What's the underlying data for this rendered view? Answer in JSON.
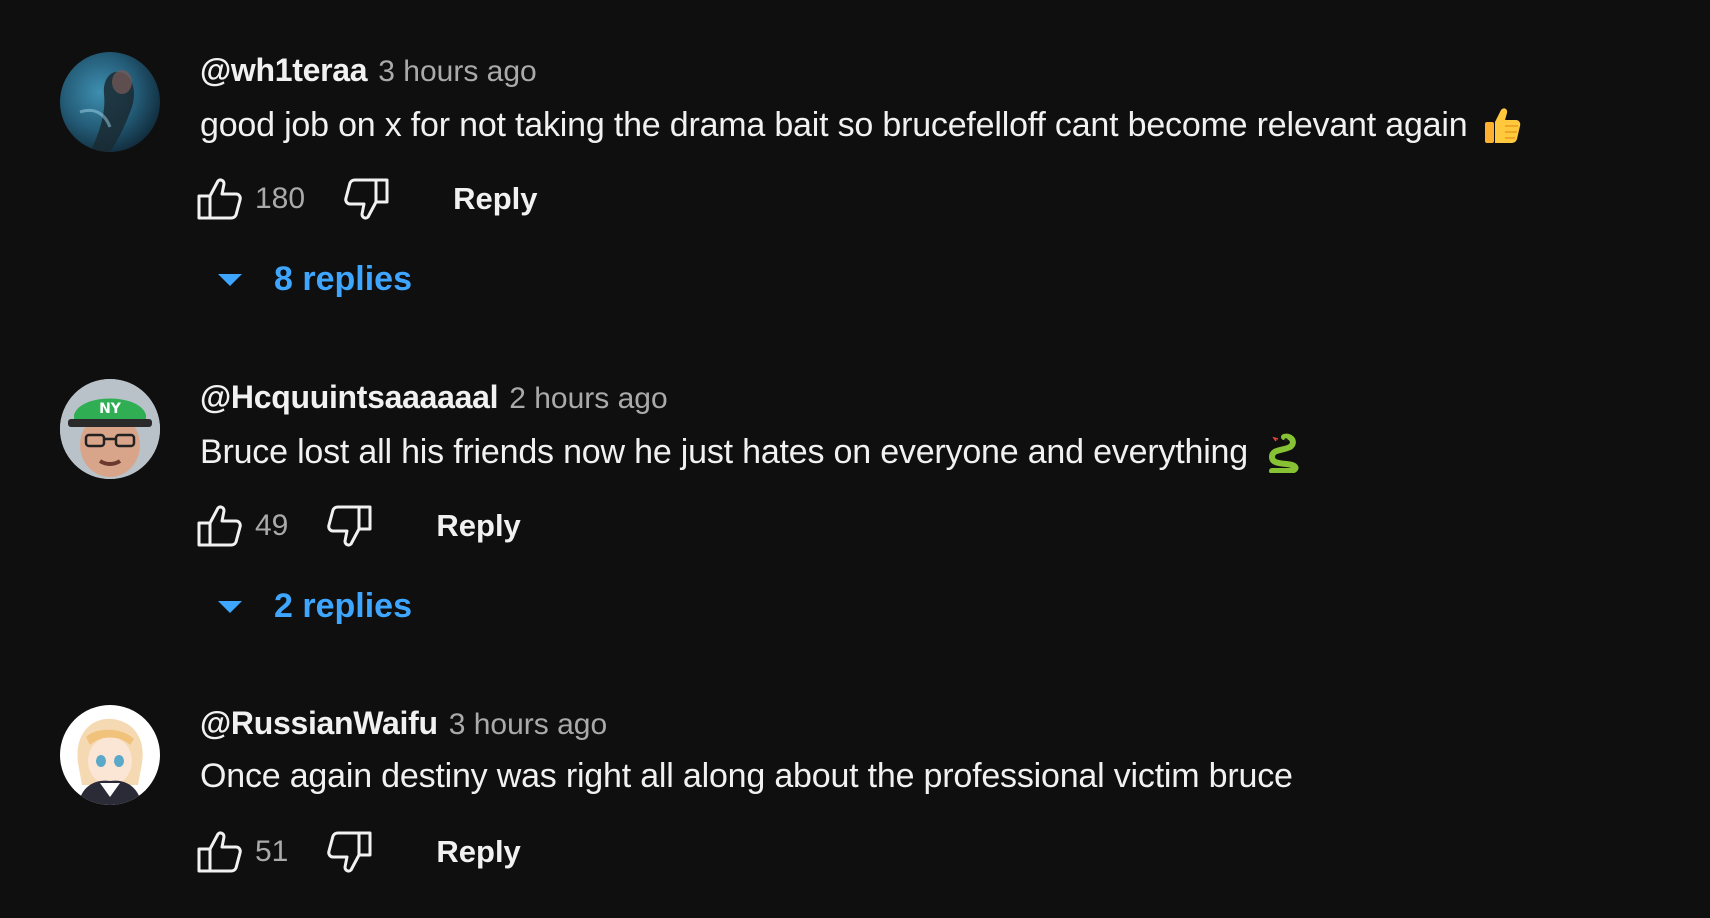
{
  "comments": [
    {
      "author": "@wh1teraa",
      "time": "3 hours ago",
      "text": "good job on x for not taking the drama bait so brucefelloff cant become relevant again",
      "emoji": "thumbs-up-emoji",
      "likes": "180",
      "reply_label": "Reply",
      "replies_label": "8 replies",
      "avatar": "dark-blue-photo-avatar"
    },
    {
      "author": "@Hcquuintsaaaaaal",
      "time": "2 hours ago",
      "text": "Bruce lost all his friends now he just hates on everyone and everything",
      "emoji": "snake-emoji",
      "likes": "49",
      "reply_label": "Reply",
      "replies_label": "2 replies",
      "avatar": "man-green-cap-avatar"
    },
    {
      "author": "@RussianWaifu",
      "time": "3 hours ago",
      "text": "Once again destiny was right all along about the professional victim bruce",
      "likes": "51",
      "reply_label": "Reply",
      "avatar": "anime-girl-avatar"
    }
  ],
  "colors": {
    "background": "#0f0f0f",
    "text": "#f1f1f1",
    "secondary_text": "#aaaaaa",
    "link": "#3ea6ff"
  },
  "icons": {
    "like": "thumbs-up-outline-icon",
    "dislike": "thumbs-down-outline-icon",
    "expand": "caret-down-icon"
  }
}
